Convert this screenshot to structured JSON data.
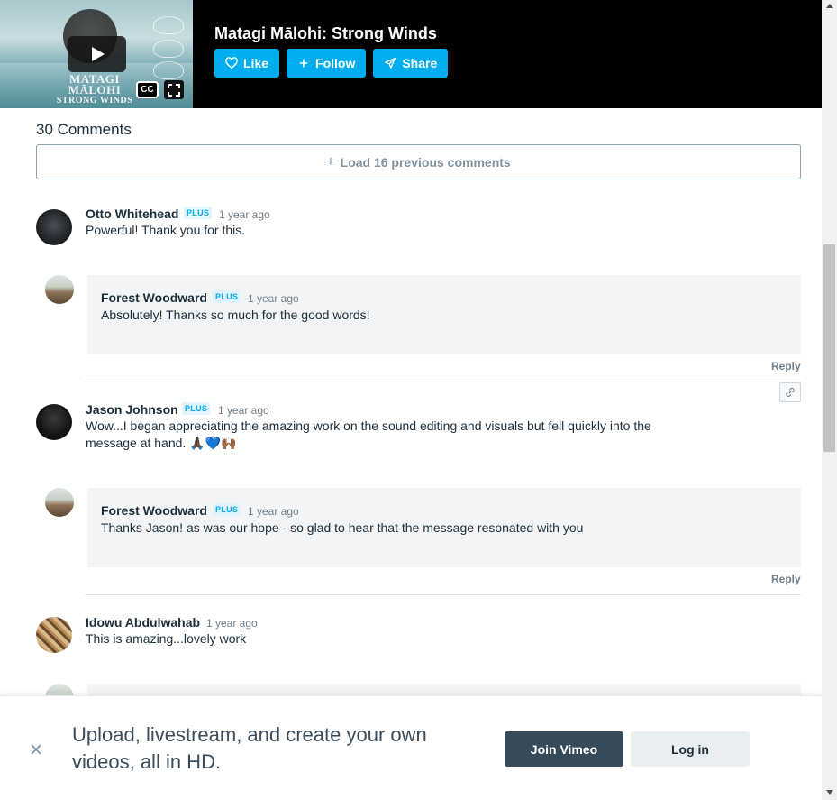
{
  "player": {
    "title": "Matagi Mālohi: Strong Winds",
    "poster_title": "MATAGI MĀLOHI",
    "poster_subtitle": "STRONG WINDS",
    "cc_label": "CC",
    "buttons": {
      "like": "Like",
      "follow": "Follow",
      "share": "Share"
    },
    "accent_color": "#00adef"
  },
  "comments": {
    "count_label": "30 Comments",
    "load_more_label": "Load 16 previous comments",
    "reply_label": "Reply",
    "badge_label": "PLUS",
    "items": [
      {
        "name": "Otto Whitehead",
        "plus": true,
        "time": "1 year ago",
        "text": "Powerful! Thank you for this.",
        "reply": {
          "name": "Forest Woodward",
          "plus": true,
          "time": "1 year ago",
          "text": "Absolutely! Thanks so much for the good words!"
        }
      },
      {
        "name": "Jason Johnson",
        "plus": true,
        "time": "1 year ago",
        "text_line1": "Wow...I began appreciating the amazing work on the sound editing and visuals but fell quickly into the",
        "text_line2": "message at hand. 🙏🏿💙🙌🏾",
        "reply": {
          "name": "Forest Woodward",
          "plus": true,
          "time": "1 year ago",
          "text": "Thanks Jason! as was our hope - so glad to hear that the message resonated with you"
        }
      },
      {
        "name": "Idowu Abdulwahab",
        "plus": false,
        "time": "1 year ago",
        "text": "This is amazing...lovely work"
      }
    ]
  },
  "banner": {
    "text": "Upload, livestream, and create your own videos, all in HD.",
    "join_label": "Join Vimeo",
    "login_label": "Log in"
  }
}
